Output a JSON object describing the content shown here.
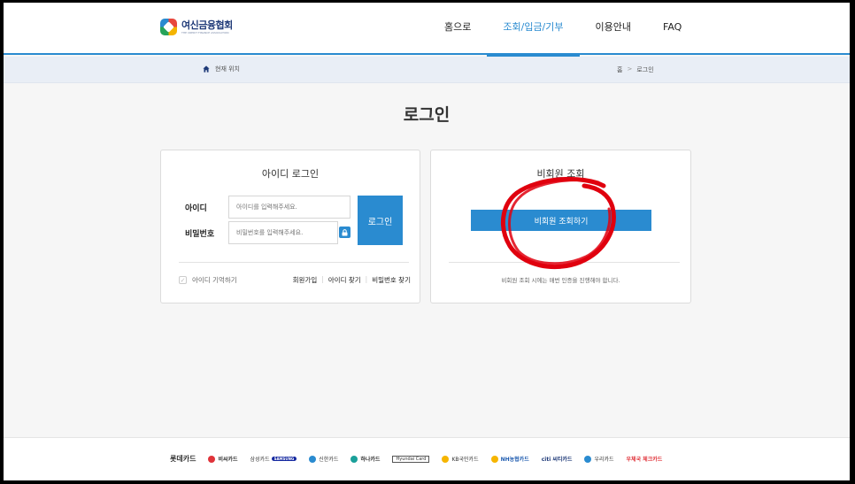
{
  "header": {
    "logo_name": "여신금융협회",
    "logo_sub": "THE CREDIT FINANCE ASSOCIATION",
    "nav": [
      "홈으로",
      "조회/입금/기부",
      "이용안내",
      "FAQ"
    ],
    "active_nav": "조회/입금/기부"
  },
  "location": {
    "label": "현재 위치",
    "crumbs": [
      "홈",
      "로그인"
    ]
  },
  "page_title": "로그인",
  "login": {
    "title": "아이디 로그인",
    "id_label": "아이디",
    "id_placeholder": "아이디를 입력해주세요.",
    "pw_label": "비밀번호",
    "pw_placeholder": "비밀번호를 입력해주세요.",
    "submit_label": "로그인",
    "remember_label": "아이디 기억하기",
    "links": [
      "회원가입",
      "아이디 찾기",
      "비밀번호 찾기"
    ]
  },
  "guest": {
    "title": "비회원 조회",
    "button_label": "비회원 조회하기",
    "note": "비회원 조회 시에는 매번 인증을 진행해야 합니다."
  },
  "footer": {
    "cards": [
      "롯데카드",
      "비씨카드",
      "삼성카드",
      "SAMSUNG",
      "신한카드",
      "하나카드",
      "Hyundai Card",
      "KB국민카드",
      "NH농협카드",
      "citi 씨티카드",
      "우리카드",
      "우체국 체크카드"
    ]
  },
  "colors": {
    "accent": "#2a8bd0",
    "annotation": "#e0000e"
  }
}
